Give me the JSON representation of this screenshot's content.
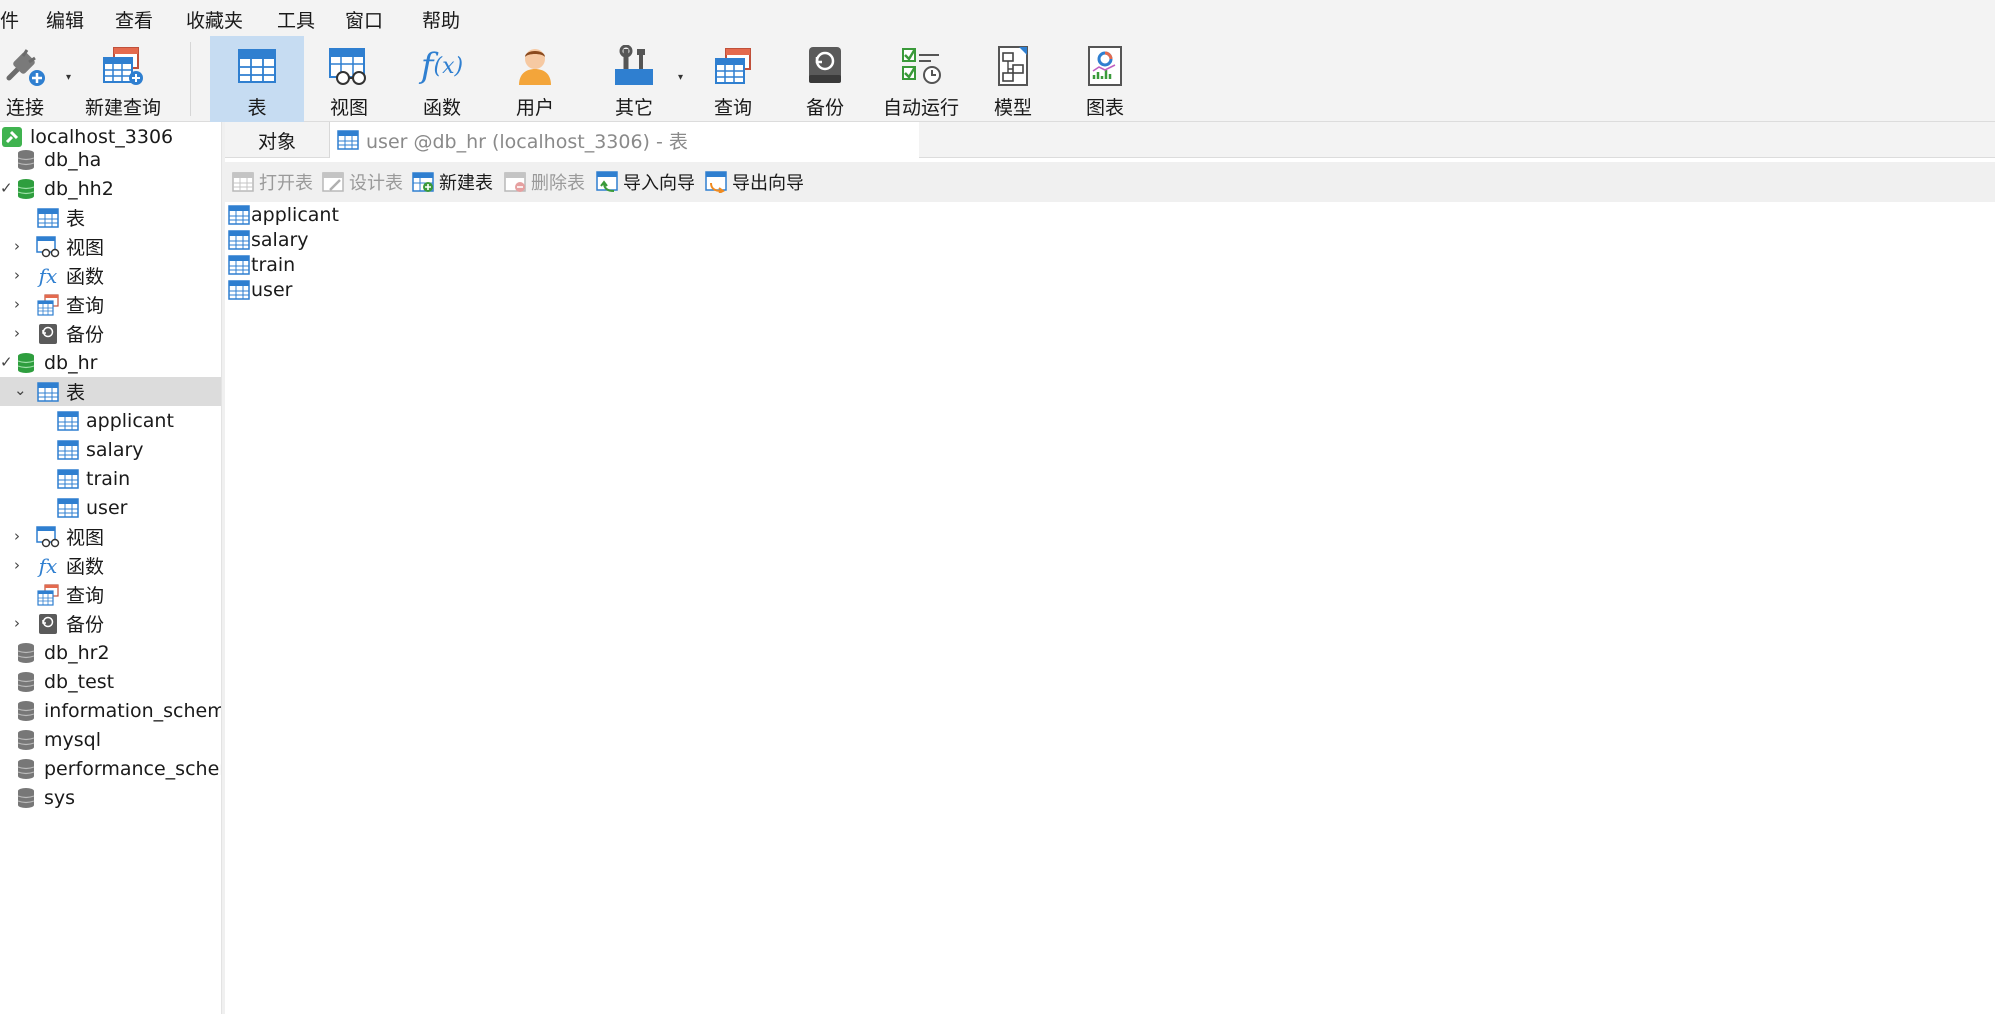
{
  "menubar": {
    "items": [
      "件",
      "编辑",
      "查看",
      "收藏夹",
      "工具",
      "窗口",
      "帮助"
    ]
  },
  "toolbar": {
    "buttons": [
      {
        "label": "连接",
        "icon": "plug-connect-icon"
      },
      {
        "label": "新建查询",
        "icon": "new-query-icon"
      },
      {
        "label": "表",
        "icon": "table-icon",
        "active": true
      },
      {
        "label": "视图",
        "icon": "view-glasses-icon"
      },
      {
        "label": "函数",
        "icon": "function-fx-icon"
      },
      {
        "label": "用户",
        "icon": "user-icon"
      },
      {
        "label": "其它",
        "icon": "tools-icon"
      },
      {
        "label": "查询",
        "icon": "query-icon"
      },
      {
        "label": "备份",
        "icon": "backup-icon"
      },
      {
        "label": "自动运行",
        "icon": "auto-run-icon"
      },
      {
        "label": "模型",
        "icon": "model-icon"
      },
      {
        "label": "图表",
        "icon": "chart-icon"
      }
    ]
  },
  "sidebar": {
    "connection": "localhost_3306",
    "db_ha": "db_ha",
    "db_hh2": "db_hh2",
    "hh2_tables": "表",
    "hh2_views": "视图",
    "hh2_functions": "函数",
    "hh2_queries": "查询",
    "hh2_backups": "备份",
    "db_hr": "db_hr",
    "hr_tables": "表",
    "hr_table_items": [
      "applicant",
      "salary",
      "train",
      "user"
    ],
    "hr_views": "视图",
    "hr_functions": "函数",
    "hr_queries": "查询",
    "hr_backups": "备份",
    "other_dbs": [
      "db_hr2",
      "db_test",
      "information_schema",
      "mysql",
      "performance_schema",
      "sys"
    ]
  },
  "tabs": {
    "objects": "对象",
    "user_tab": "user @db_hr (localhost_3306) - 表"
  },
  "object_toolbar": {
    "open": "打开表",
    "design": "设计表",
    "new": "新建表",
    "delete": "删除表",
    "import": "导入向导",
    "export": "导出向导"
  },
  "objects": [
    "applicant",
    "salary",
    "train",
    "user"
  ],
  "colors": {
    "accent_active": "#c6dcf2",
    "db_open_green": "#2e9e3e",
    "table_blue": "#2f7fd0",
    "selected_row": "#dcdcdc"
  }
}
